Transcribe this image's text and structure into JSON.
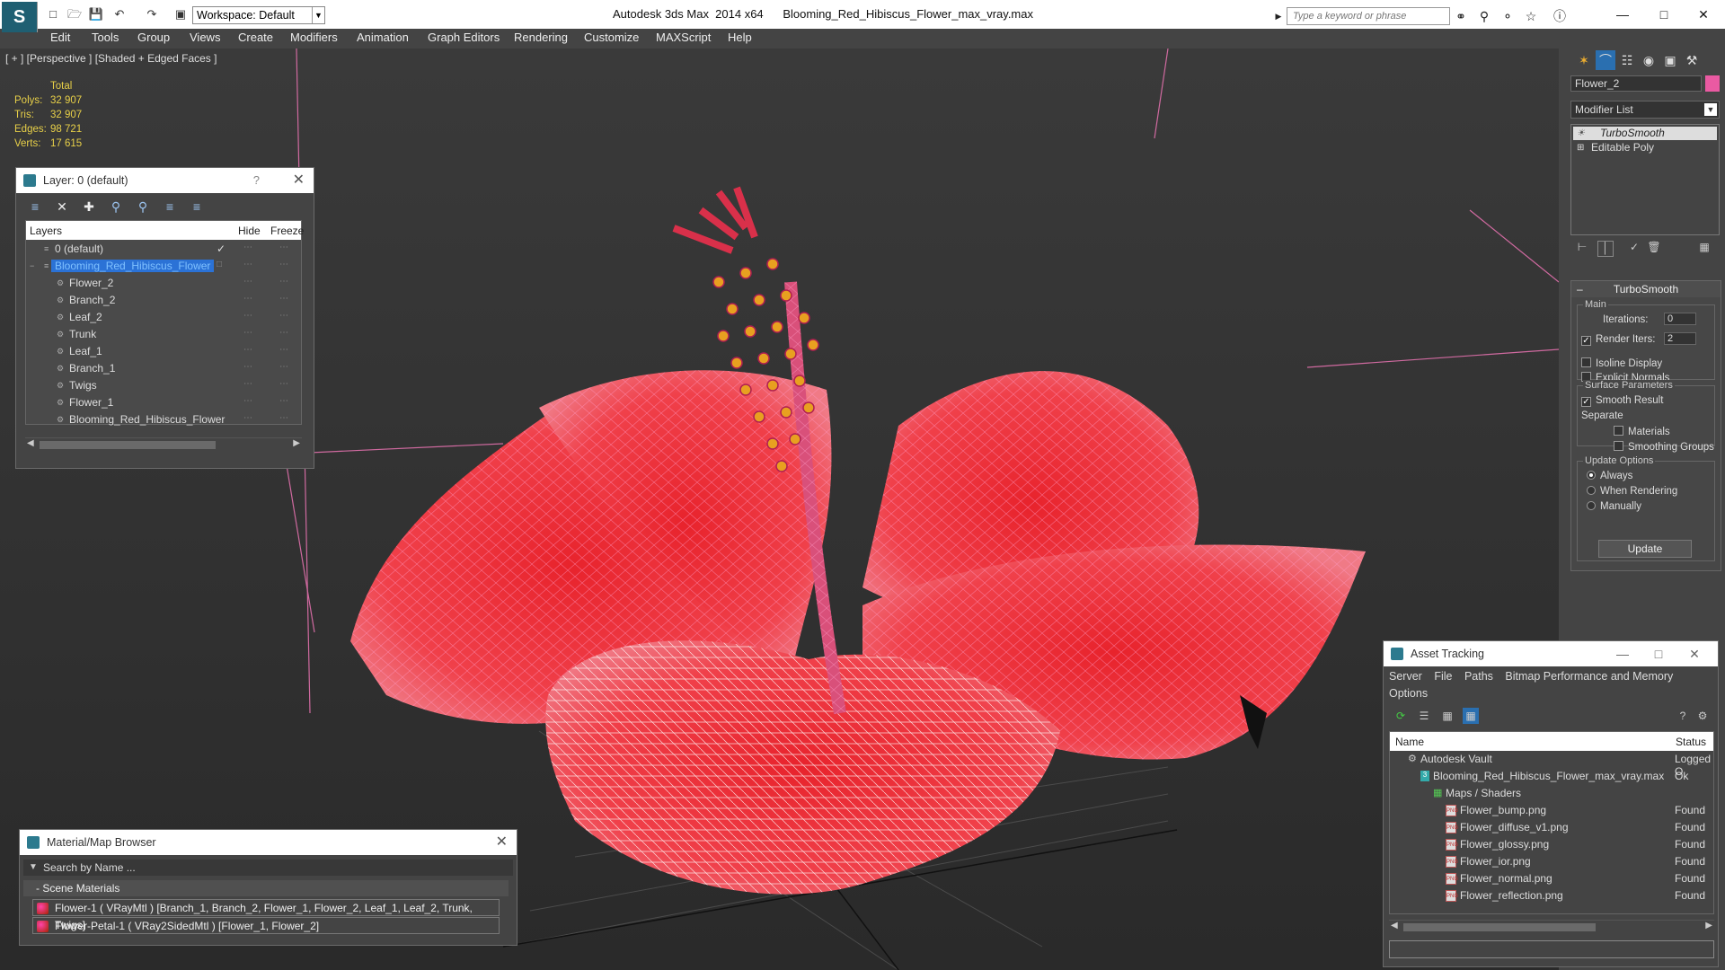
{
  "titlebar": {
    "workspace": "Workspace: Default",
    "app_name": "Autodesk 3ds Max  2014 x64",
    "file_name": "Blooming_Red_Hibiscus_Flower_max_vray.max",
    "search_placeholder": "Type a keyword or phrase"
  },
  "menu": [
    "Edit",
    "Tools",
    "Group",
    "Views",
    "Create",
    "Modifiers",
    "Animation",
    "Graph Editors",
    "Rendering",
    "Customize",
    "MAXScript",
    "Help"
  ],
  "viewport": {
    "label": "[ + ] [Perspective ] [Shaded + Edged Faces ]",
    "stats": {
      "header": "Total",
      "rows": [
        {
          "label": "Polys:",
          "value": "32 907"
        },
        {
          "label": "Tris:",
          "value": "32 907"
        },
        {
          "label": "Edges:",
          "value": "98 721"
        },
        {
          "label": "Verts:",
          "value": "17 615"
        }
      ]
    }
  },
  "layer_panel": {
    "title": "Layer: 0 (default)",
    "help": "?",
    "columns": {
      "layers": "Layers",
      "hide": "Hide",
      "freeze": "Freeze"
    },
    "rows": [
      {
        "name": "0 (default)",
        "level": 1,
        "checked": true
      },
      {
        "name": "Blooming_Red_Hibiscus_Flower",
        "level": 1,
        "selected": true
      },
      {
        "name": "Flower_2",
        "level": 2
      },
      {
        "name": "Branch_2",
        "level": 2
      },
      {
        "name": "Leaf_2",
        "level": 2
      },
      {
        "name": "Trunk",
        "level": 2
      },
      {
        "name": "Leaf_1",
        "level": 2
      },
      {
        "name": "Branch_1",
        "level": 2
      },
      {
        "name": "Twigs",
        "level": 2
      },
      {
        "name": "Flower_1",
        "level": 2
      },
      {
        "name": "Blooming_Red_Hibiscus_Flower",
        "level": 2
      }
    ]
  },
  "material_browser": {
    "title": "Material/Map Browser",
    "search_placeholder": "Search by Name ...",
    "section": "- Scene Materials",
    "rows": [
      "Flower-1  ( VRayMtl )  [Branch_1, Branch_2, Flower_1, Flower_2, Leaf_1, Leaf_2, Trunk, Twigs]",
      "Flower-Petal-1  ( VRay2SidedMtl )  [Flower_1, Flower_2]"
    ]
  },
  "command_panel": {
    "object_name": "Flower_2",
    "object_color": "#ea5aa2",
    "modifier_list": "Modifier List",
    "stack": [
      {
        "name": "TurboSmooth",
        "italic": true
      },
      {
        "name": "Editable Poly",
        "italic": false
      }
    ],
    "rollout": {
      "title": "TurboSmooth",
      "main_group": "Main",
      "iterations_label": "Iterations:",
      "iterations_value": "0",
      "render_iters_label": "Render Iters:",
      "render_iters_value": "2",
      "isoline": "Isoline Display",
      "explicit_normals": "Explicit Normals",
      "surface_group": "Surface Parameters",
      "smooth_result": "Smooth Result",
      "separate": "Separate",
      "materials": "Materials",
      "smoothing_groups": "Smoothing Groups",
      "update_group": "Update Options",
      "always": "Always",
      "when_rendering": "When Rendering",
      "manually": "Manually",
      "update_btn": "Update"
    }
  },
  "asset_tracking": {
    "title": "Asset Tracking",
    "menu": [
      "Server",
      "File",
      "Paths",
      "Bitmap Performance and Memory",
      "Options"
    ],
    "columns": {
      "name": "Name",
      "status": "Status"
    },
    "rows": [
      {
        "name": "Autodesk Vault",
        "status": "Logged O",
        "indent": 1
      },
      {
        "name": "Blooming_Red_Hibiscus_Flower_max_vray.max",
        "status": "Ok",
        "indent": 2
      },
      {
        "name": "Maps / Shaders",
        "status": "",
        "indent": 3
      },
      {
        "name": "Flower_bump.png",
        "status": "Found",
        "indent": 4
      },
      {
        "name": "Flower_diffuse_v1.png",
        "status": "Found",
        "indent": 4
      },
      {
        "name": "Flower_glossy.png",
        "status": "Found",
        "indent": 4
      },
      {
        "name": "Flower_ior.png",
        "status": "Found",
        "indent": 4
      },
      {
        "name": "Flower_normal.png",
        "status": "Found",
        "indent": 4
      },
      {
        "name": "Flower_reflection.png",
        "status": "Found",
        "indent": 4
      }
    ]
  }
}
